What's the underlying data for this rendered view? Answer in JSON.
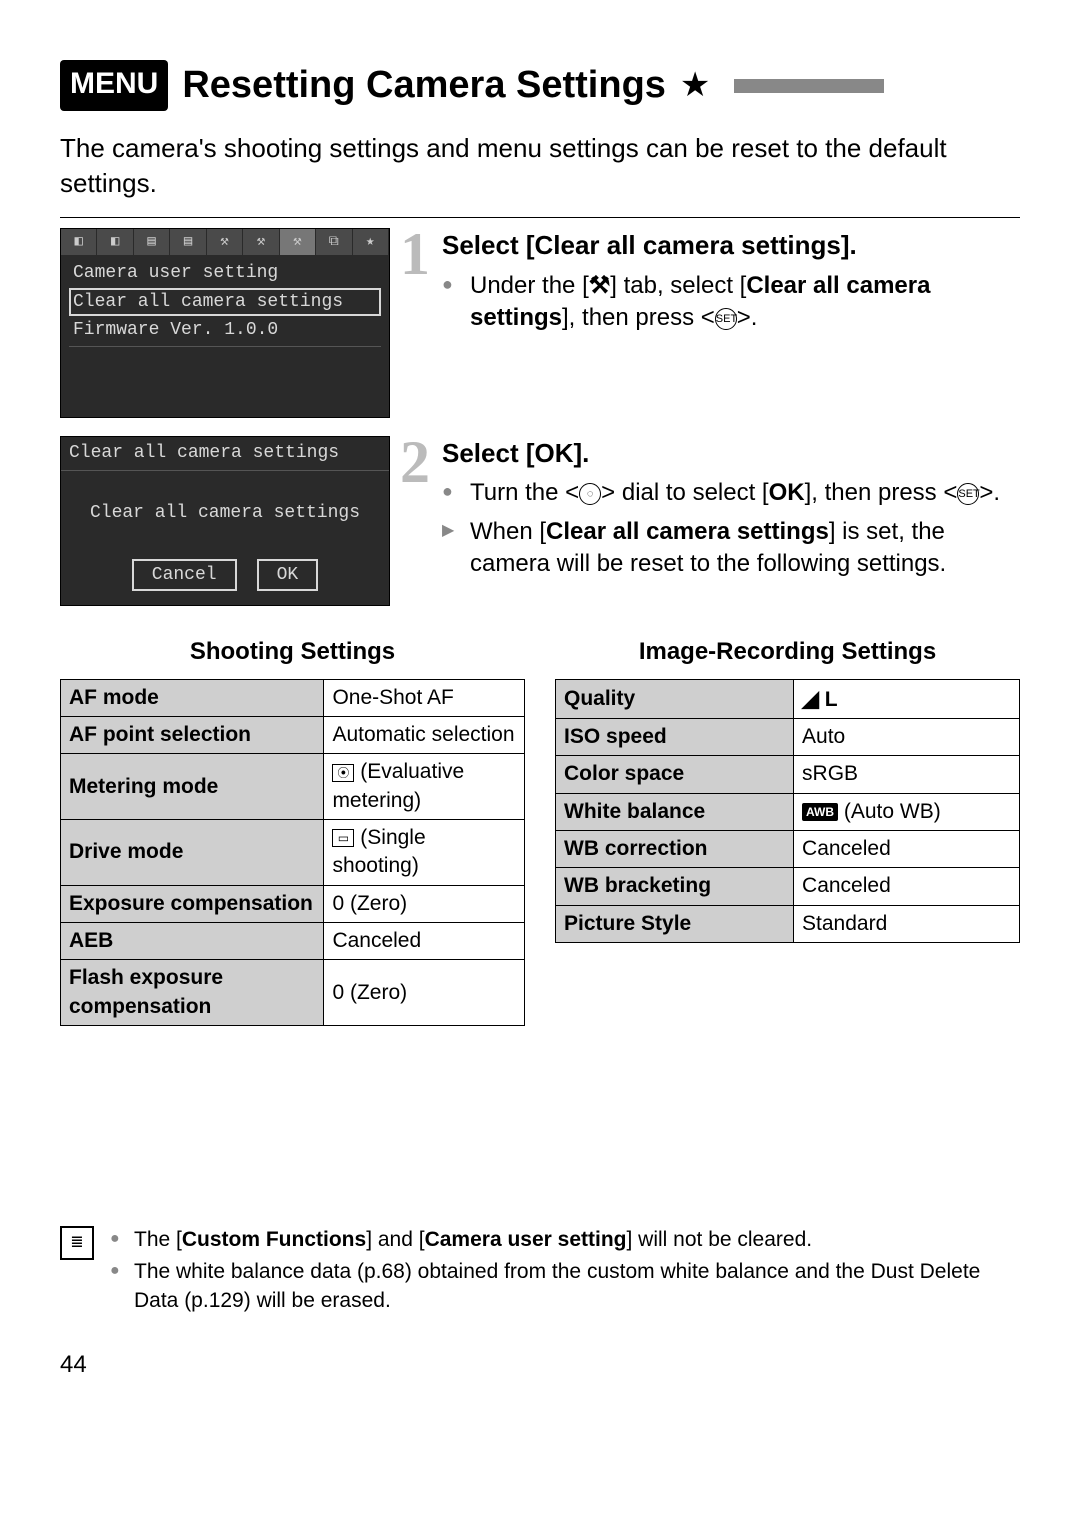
{
  "header": {
    "menu_badge": "MENU",
    "title": "Resetting Camera Settings",
    "star": "★"
  },
  "intro": "The camera's shooting settings and menu settings can be reset to the default settings.",
  "lcd1": {
    "items": [
      "Camera user setting",
      "Clear all camera settings",
      "Firmware Ver. 1.0.0"
    ],
    "selected_index": 1
  },
  "lcd2": {
    "title": "Clear all camera settings",
    "message": "Clear all camera settings",
    "cancel": "Cancel",
    "ok": "OK"
  },
  "step1": {
    "num": "1",
    "heading": "Select [Clear all camera settings].",
    "bullet_pre": "Under the [",
    "bullet_icon": "⚒",
    "bullet_mid": "] tab, select [",
    "bullet_bold": "Clear all camera settings",
    "bullet_post": "], then press <",
    "bullet_set": "SET",
    "bullet_end": ">."
  },
  "step2": {
    "num": "2",
    "heading": "Select [OK].",
    "b1_pre": "Turn the <",
    "b1_dial": "◌",
    "b1_mid": "> dial to select [",
    "b1_ok": "OK",
    "b1_post": "], then press <",
    "b1_set": "SET",
    "b1_end": ">.",
    "b2_pre": "When [",
    "b2_bold": "Clear all camera settings",
    "b2_post": "] is set, the camera will be reset to the following settings."
  },
  "tables": {
    "shooting": {
      "title": "Shooting Settings",
      "rows": [
        {
          "k": "AF mode",
          "v": "One-Shot AF"
        },
        {
          "k": "AF point selection",
          "v": "Automatic selection"
        },
        {
          "k": "Metering mode",
          "v": "(Evaluative metering)",
          "icon": "⦿"
        },
        {
          "k": "Drive mode",
          "v": "(Single shooting)",
          "icon": "▭"
        },
        {
          "k": "Exposure compensation",
          "v": "0 (Zero)"
        },
        {
          "k": "AEB",
          "v": "Canceled"
        },
        {
          "k": "Flash exposure compensation",
          "v": "0 (Zero)"
        }
      ]
    },
    "image": {
      "title": "Image-Recording Settings",
      "rows": [
        {
          "k": "Quality",
          "v": "L",
          "icon": "◢"
        },
        {
          "k": "ISO speed",
          "v": "Auto"
        },
        {
          "k": "Color space",
          "v": "sRGB"
        },
        {
          "k": "White balance",
          "v": "(Auto WB)",
          "icon": "AWB"
        },
        {
          "k": "WB correction",
          "v": "Canceled"
        },
        {
          "k": "WB bracketing",
          "v": "Canceled"
        },
        {
          "k": "Picture Style",
          "v": "Standard"
        }
      ]
    }
  },
  "footnote": {
    "n1_pre": "The [",
    "n1_b1": "Custom Functions",
    "n1_mid": "] and [",
    "n1_b2": "Camera user setting",
    "n1_end": "] will not be cleared.",
    "n2": "The white balance data (p.68) obtained from the custom white balance and the Dust Delete Data (p.129) will be erased."
  },
  "page_number": "44"
}
